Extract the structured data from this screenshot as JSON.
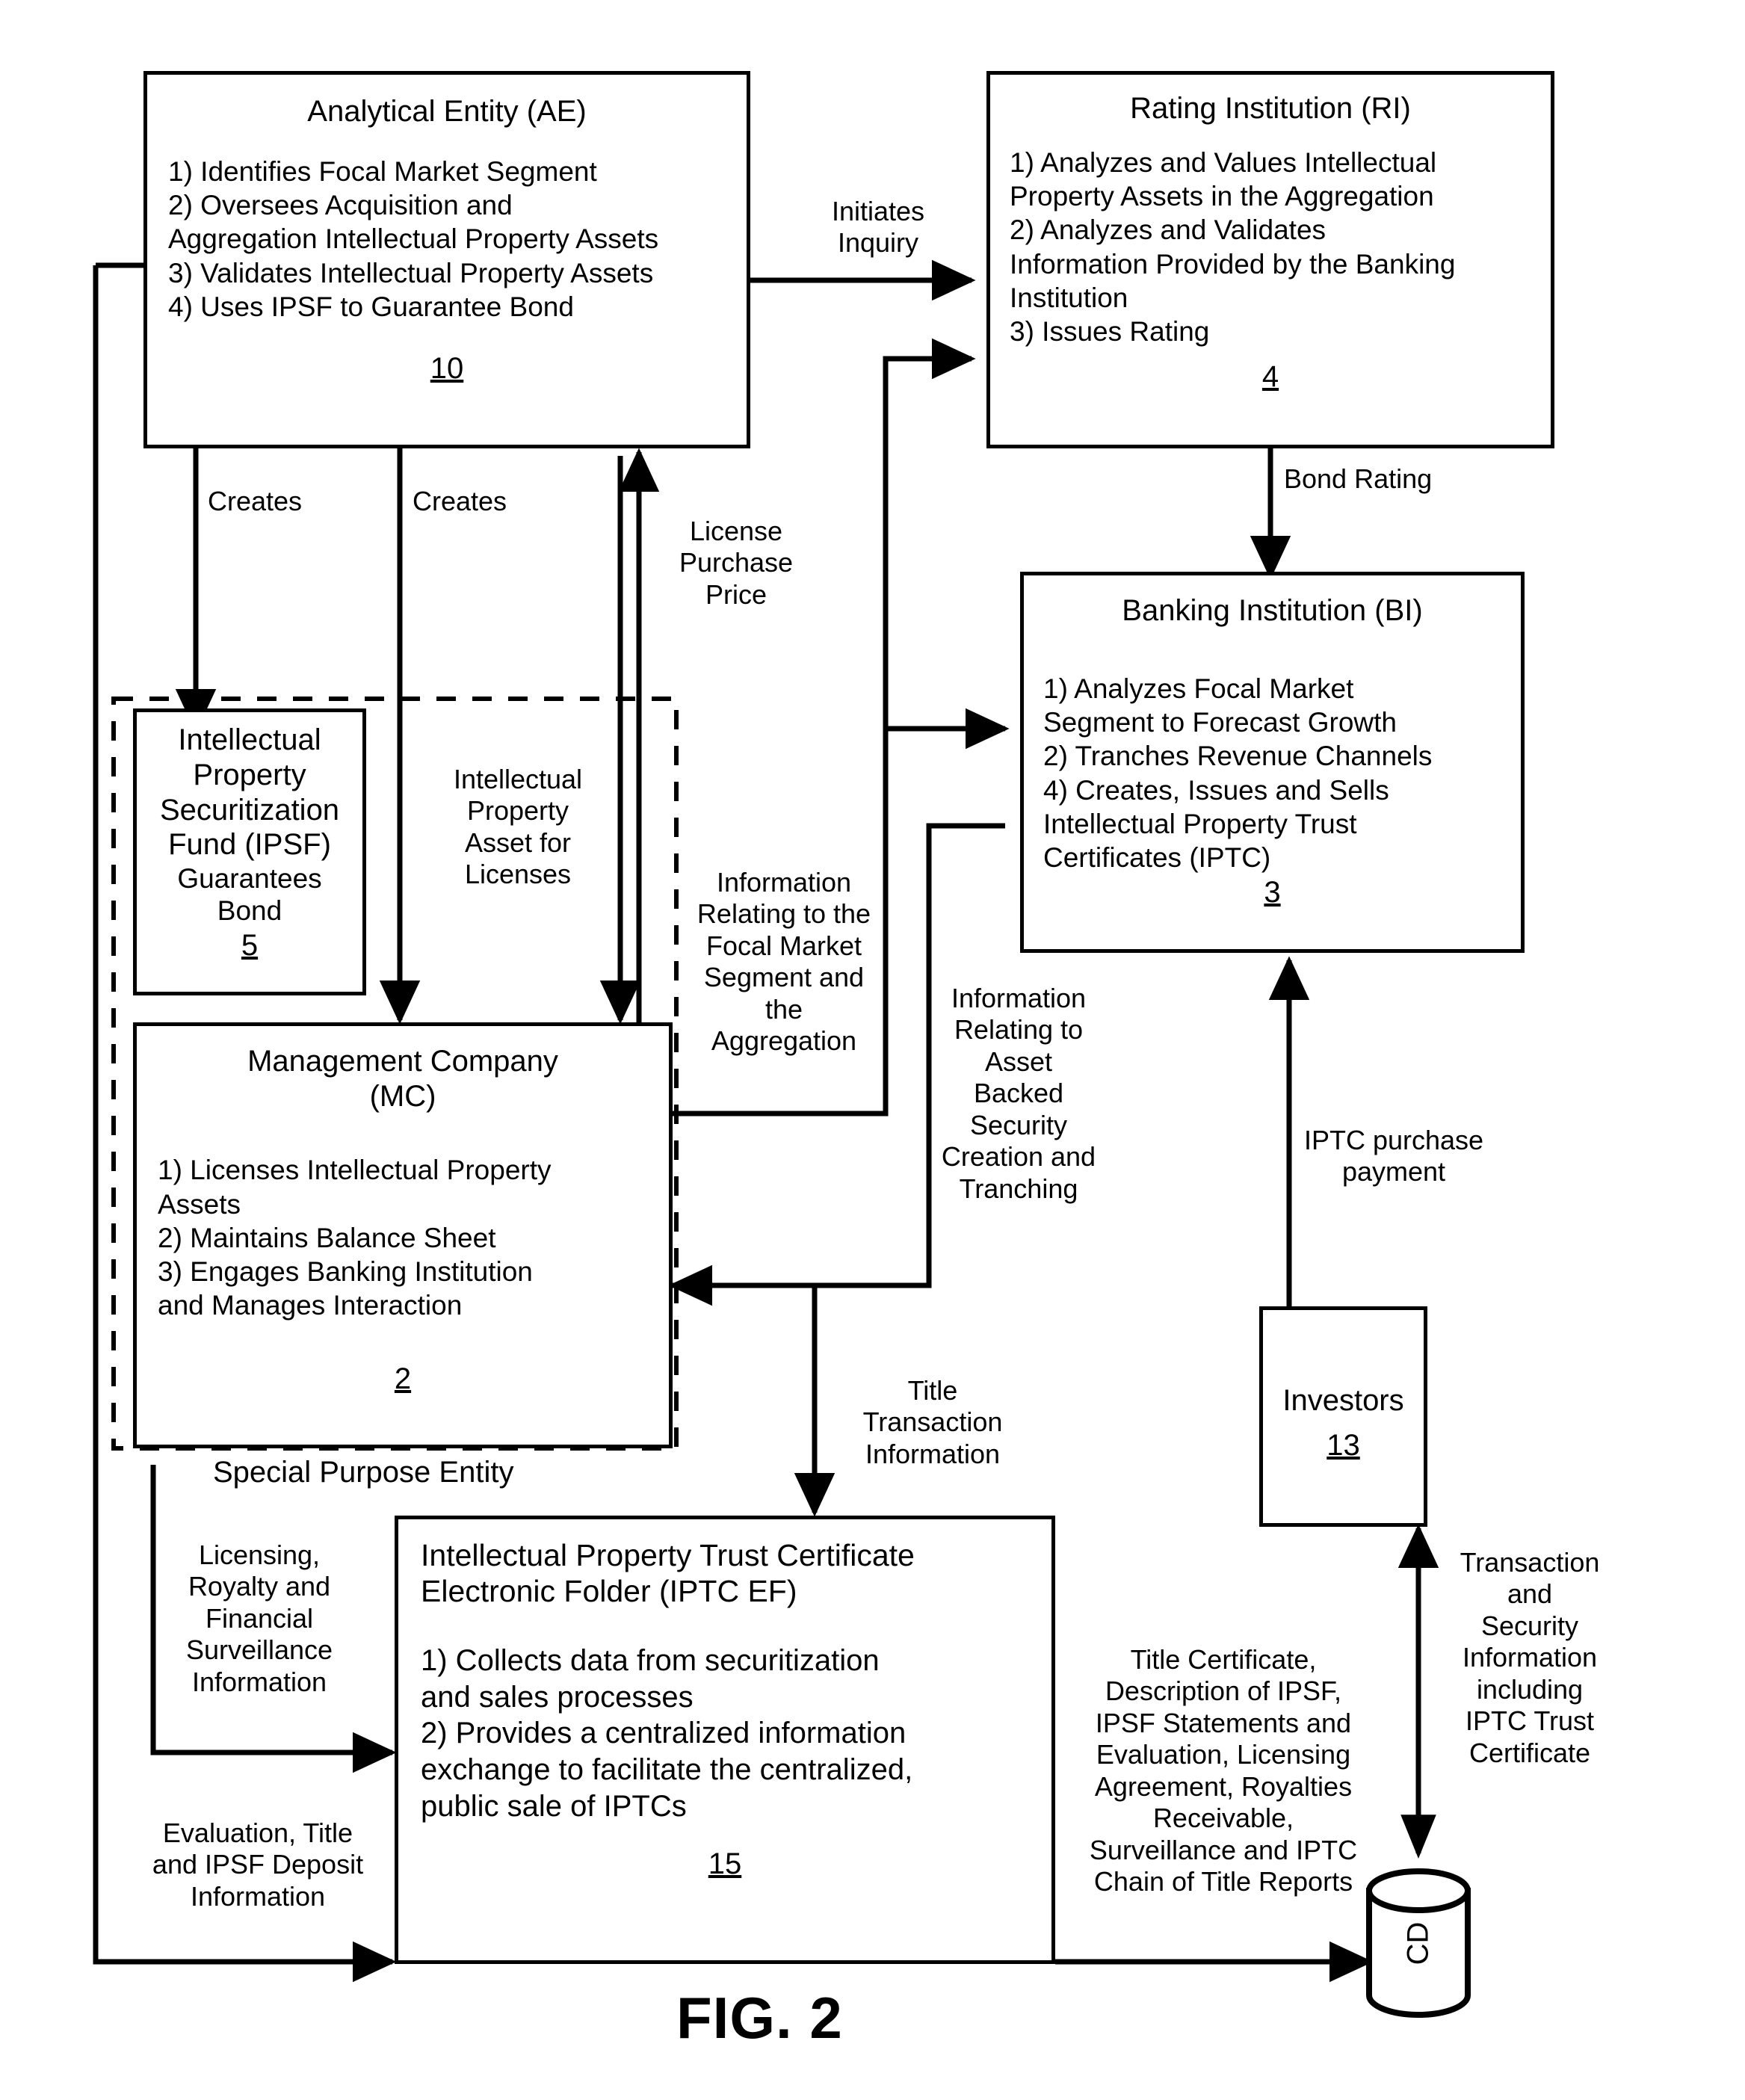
{
  "figure": {
    "caption": "FIG. 2"
  },
  "boxes": {
    "analytical_entity": {
      "title": "Analytical Entity (AE)",
      "items": [
        "1) Identifies Focal Market Segment",
        "2) Oversees Acquisition  and",
        "Aggregation Intellectual Property Assets",
        "3) Validates Intellectual Property Assets",
        "4) Uses IPSF to Guarantee Bond"
      ],
      "ref": "10"
    },
    "rating_institution": {
      "title": "Rating Institution (RI)",
      "items": [
        "1) Analyzes and Values Intellectual",
        "Property Assets in the Aggregation",
        "2) Analyzes and Validates",
        "Information Provided by the Banking",
        "Institution",
        "3) Issues Rating"
      ],
      "ref": "4"
    },
    "banking_institution": {
      "title": "Banking Institution (BI)",
      "items": [
        "1) Analyzes Focal Market",
        "Segment to Forecast Growth",
        "2) Tranches Revenue Channels",
        "4) Creates, Issues and Sells",
        "Intellectual Property Trust",
        "Certificates (IPTC)"
      ],
      "ref": "3"
    },
    "ipsf": {
      "title_lines": [
        "Intellectual",
        "Property",
        "Securitization",
        "Fund (IPSF)"
      ],
      "sub_lines": [
        "Guarantees",
        "Bond"
      ],
      "ref": "5"
    },
    "management_company": {
      "title_lines": [
        "Management Company",
        "(MC)"
      ],
      "items": [
        "1) Licenses Intellectual Property",
        "Assets",
        "2) Maintains Balance Sheet",
        "3) Engages Banking Institution",
        "and Manages Interaction"
      ],
      "ref": "2"
    },
    "iptc_ef": {
      "title_lines": [
        "Intellectual Property Trust Certificate",
        "Electronic Folder (IPTC EF)"
      ],
      "items": [
        "1) Collects data from securitization",
        "and sales processes",
        "2) Provides a centralized information",
        "exchange to facilitate the centralized,",
        "public sale of IPTCs"
      ],
      "ref": "15"
    },
    "investors": {
      "title": "Investors",
      "ref": "13"
    },
    "database": {
      "label": "CD"
    }
  },
  "grouping": {
    "special_purpose_entity": "Special Purpose Entity"
  },
  "edge_labels": {
    "initiates_inquiry": [
      "Initiates",
      "Inquiry"
    ],
    "bond_rating": [
      "Bond Rating"
    ],
    "creates_left": [
      "Creates"
    ],
    "creates_right": [
      "Creates"
    ],
    "license_purchase_price": [
      "License",
      "Purchase",
      "Price"
    ],
    "ip_asset_for_licenses": [
      "Intellectual",
      "Property",
      "Asset for",
      "Licenses"
    ],
    "info_focal_market": [
      "Information",
      "Relating to the",
      "Focal Market",
      "Segment and",
      "the",
      "Aggregation"
    ],
    "info_asset_backed": [
      "Information",
      "Relating to",
      "Asset",
      "Backed",
      "Security",
      "Creation and",
      "Tranching"
    ],
    "iptc_purchase_payment": [
      "IPTC purchase",
      "payment"
    ],
    "title_transaction_info": [
      "Title",
      "Transaction",
      "Information"
    ],
    "licensing_royalty": [
      "Licensing,",
      "Royalty and",
      "Financial",
      "Surveillance",
      "Information"
    ],
    "evaluation_title_ipsf": [
      "Evaluation, Title",
      "and IPSF Deposit",
      "Information"
    ],
    "title_certificate_bundle": [
      "Title Certificate,",
      "Description of IPSF,",
      "IPSF Statements and",
      "Evaluation, Licensing",
      "Agreement, Royalties",
      "Receivable,",
      "Surveillance and IPTC",
      "Chain of Title Reports"
    ],
    "transaction_security_info": [
      "Transaction",
      "and",
      "Security",
      "Information",
      "including",
      "IPTC Trust",
      "Certificate"
    ]
  },
  "colors": {
    "ink": "#000000",
    "paper": "#ffffff"
  }
}
